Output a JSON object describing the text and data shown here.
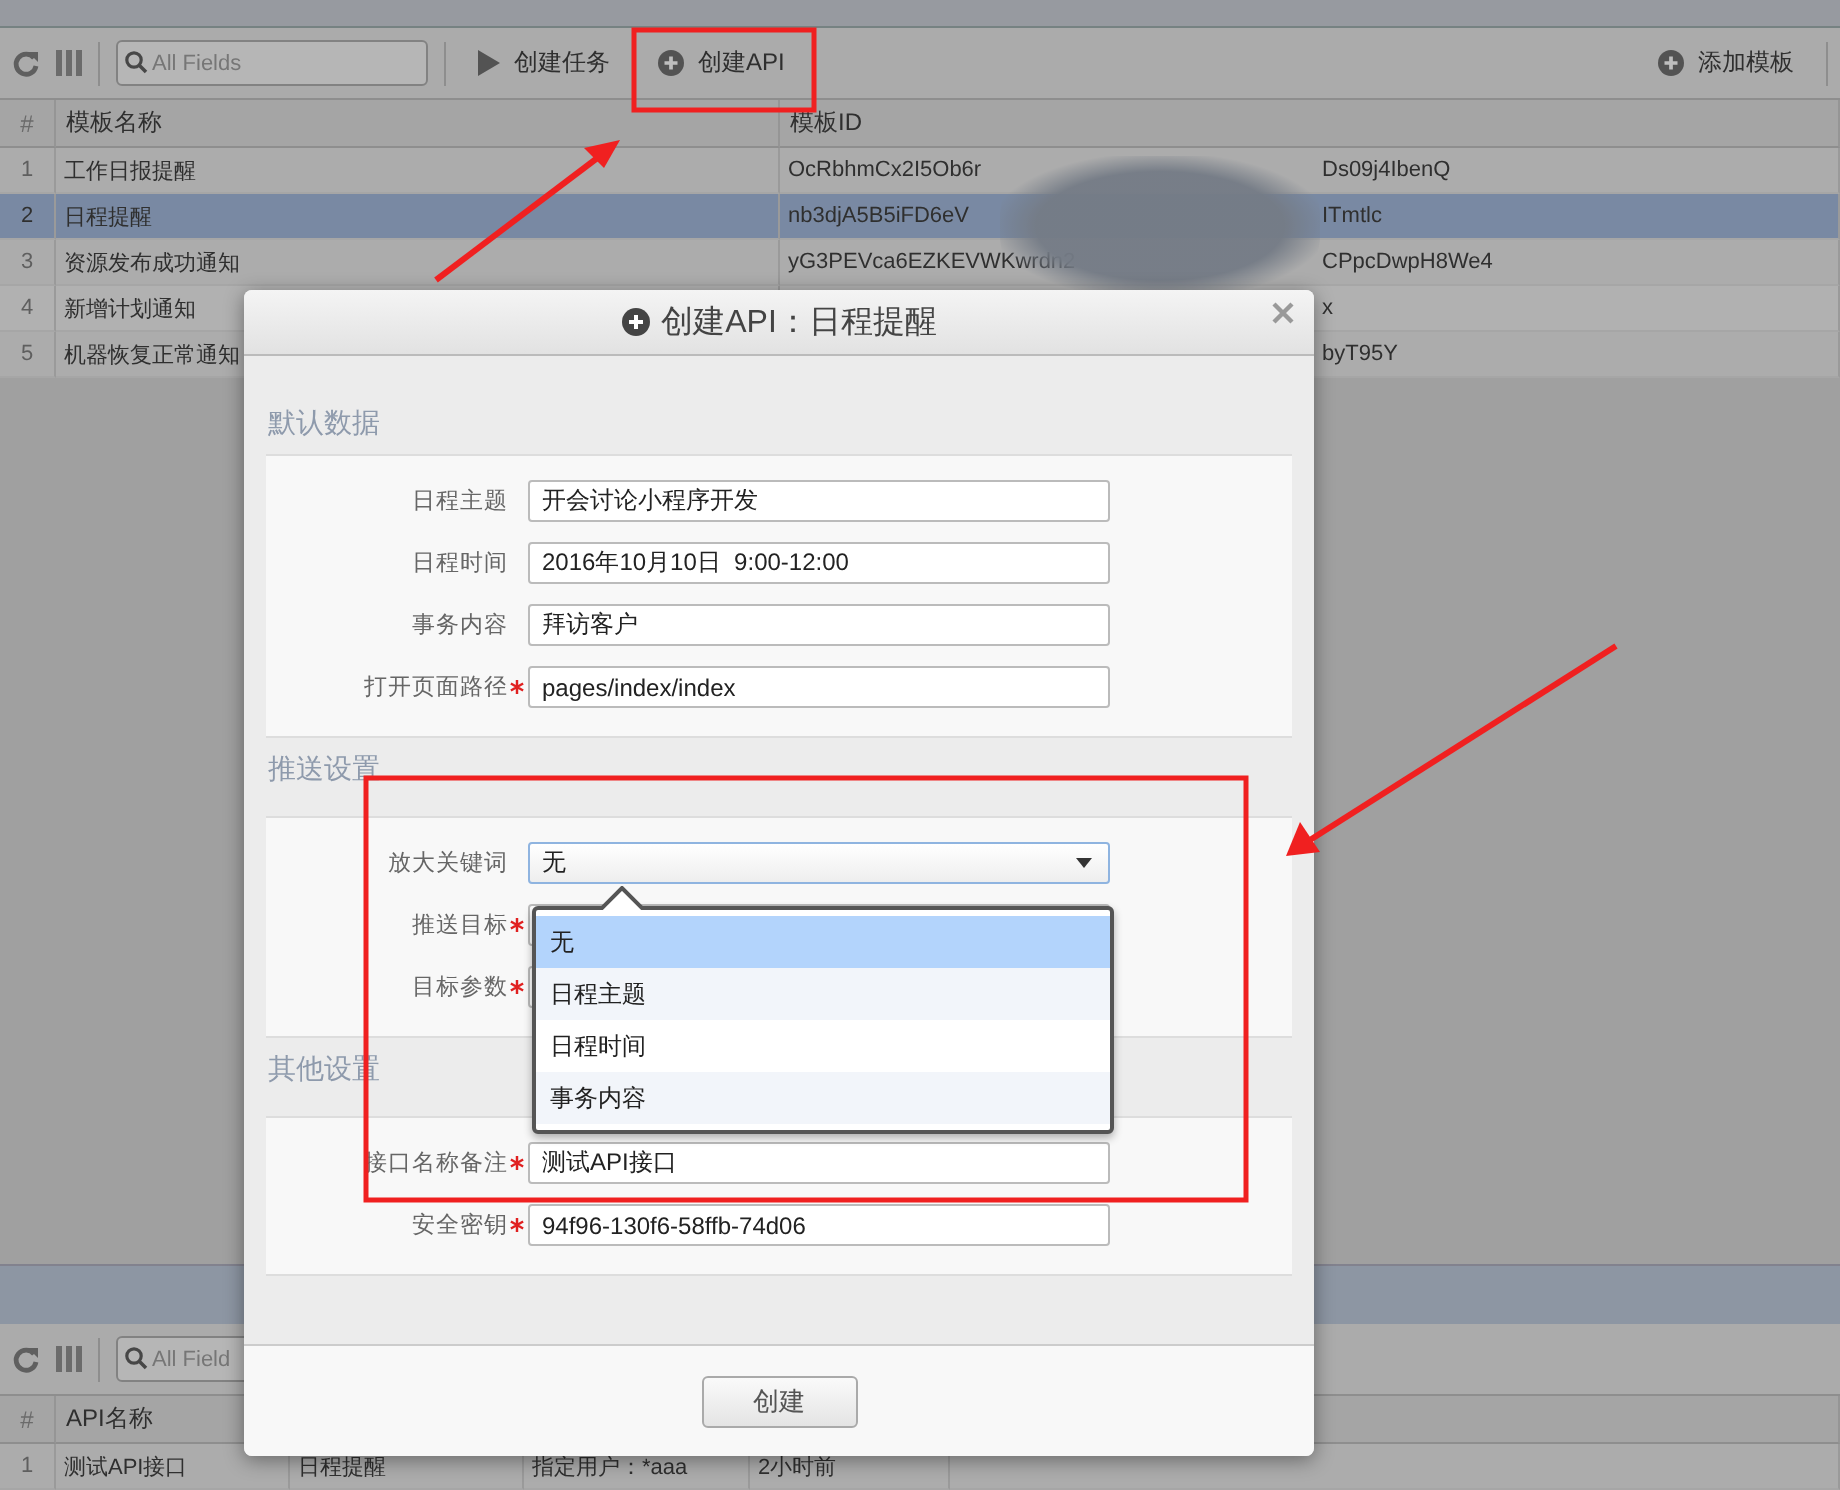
{
  "toolbar": {
    "search": {
      "placeholder": "All Fields"
    },
    "buttons": [
      {
        "label": "创建任务"
      },
      {
        "label": "创建API"
      }
    ],
    "right_button": {
      "label": "添加模板"
    }
  },
  "template_table": {
    "columns": [
      "#",
      "模板名称",
      "模板ID"
    ],
    "rows": [
      {
        "index": "1",
        "name": "工作日报提醒",
        "id_start": "OcRbhmCx2I5Ob6r",
        "id_end": "Ds09j4IbenQ",
        "selected": false
      },
      {
        "index": "2",
        "name": "日程提醒",
        "id_start": "nb3djA5B5iFD6eV",
        "id_end": "ITmtlc",
        "selected": true
      },
      {
        "index": "3",
        "name": "资源发布成功通知",
        "id_start": "yG3PEVca6EZKEVWKwrdn2",
        "id_end": "CPpcDwpH8We4",
        "selected": false
      },
      {
        "index": "4",
        "name": "新增计划通知",
        "id_end": "x",
        "selected": false
      },
      {
        "index": "5",
        "name": "机器恢复正常通知",
        "id_end": "byT95Y",
        "selected": false
      }
    ]
  },
  "api_panel": {
    "search": {
      "placeholder": "All Field"
    },
    "columns": [
      "#",
      "API名称"
    ],
    "rows": [
      {
        "cells": [
          "1",
          "测试API接口",
          "日程提醒",
          "指定用户：*aaa",
          "2小时前"
        ]
      }
    ]
  },
  "dialog": {
    "title": "创建API：日程提醒",
    "sections": [
      {
        "title": "默认数据",
        "fields": [
          {
            "label": "日程主题",
            "kind": "text",
            "value": "开会讨论小程序开发",
            "required": false
          },
          {
            "label": "日程时间",
            "kind": "text",
            "value": "2016年10月10日  9:00-12:00",
            "required": false
          },
          {
            "label": "事务内容",
            "kind": "text",
            "value": "拜访客户",
            "required": false
          },
          {
            "label": "打开页面路径",
            "kind": "text",
            "value": "pages/index/index",
            "required": true
          }
        ]
      },
      {
        "title": "推送设置",
        "fields": [
          {
            "label": "放大关键词",
            "kind": "select",
            "value": "无",
            "required": false,
            "open": true,
            "options": [
              {
                "label": "无",
                "selected": true
              },
              {
                "label": "日程主题",
                "selected": false
              },
              {
                "label": "日程时间",
                "selected": false
              },
              {
                "label": "事务内容",
                "selected": false
              }
            ]
          },
          {
            "label": "推送目标",
            "kind": "text",
            "required": true
          },
          {
            "label": "目标参数",
            "kind": "text",
            "required": true
          }
        ]
      },
      {
        "title": "其他设置",
        "fields": [
          {
            "label": "接口名称备注",
            "kind": "text",
            "value": "测试API接口",
            "required": true
          },
          {
            "label": "安全密钥",
            "kind": "text",
            "value": "94f96-130f6-58ffb-74d06",
            "required": true
          }
        ]
      }
    ],
    "submit": "创建"
  }
}
